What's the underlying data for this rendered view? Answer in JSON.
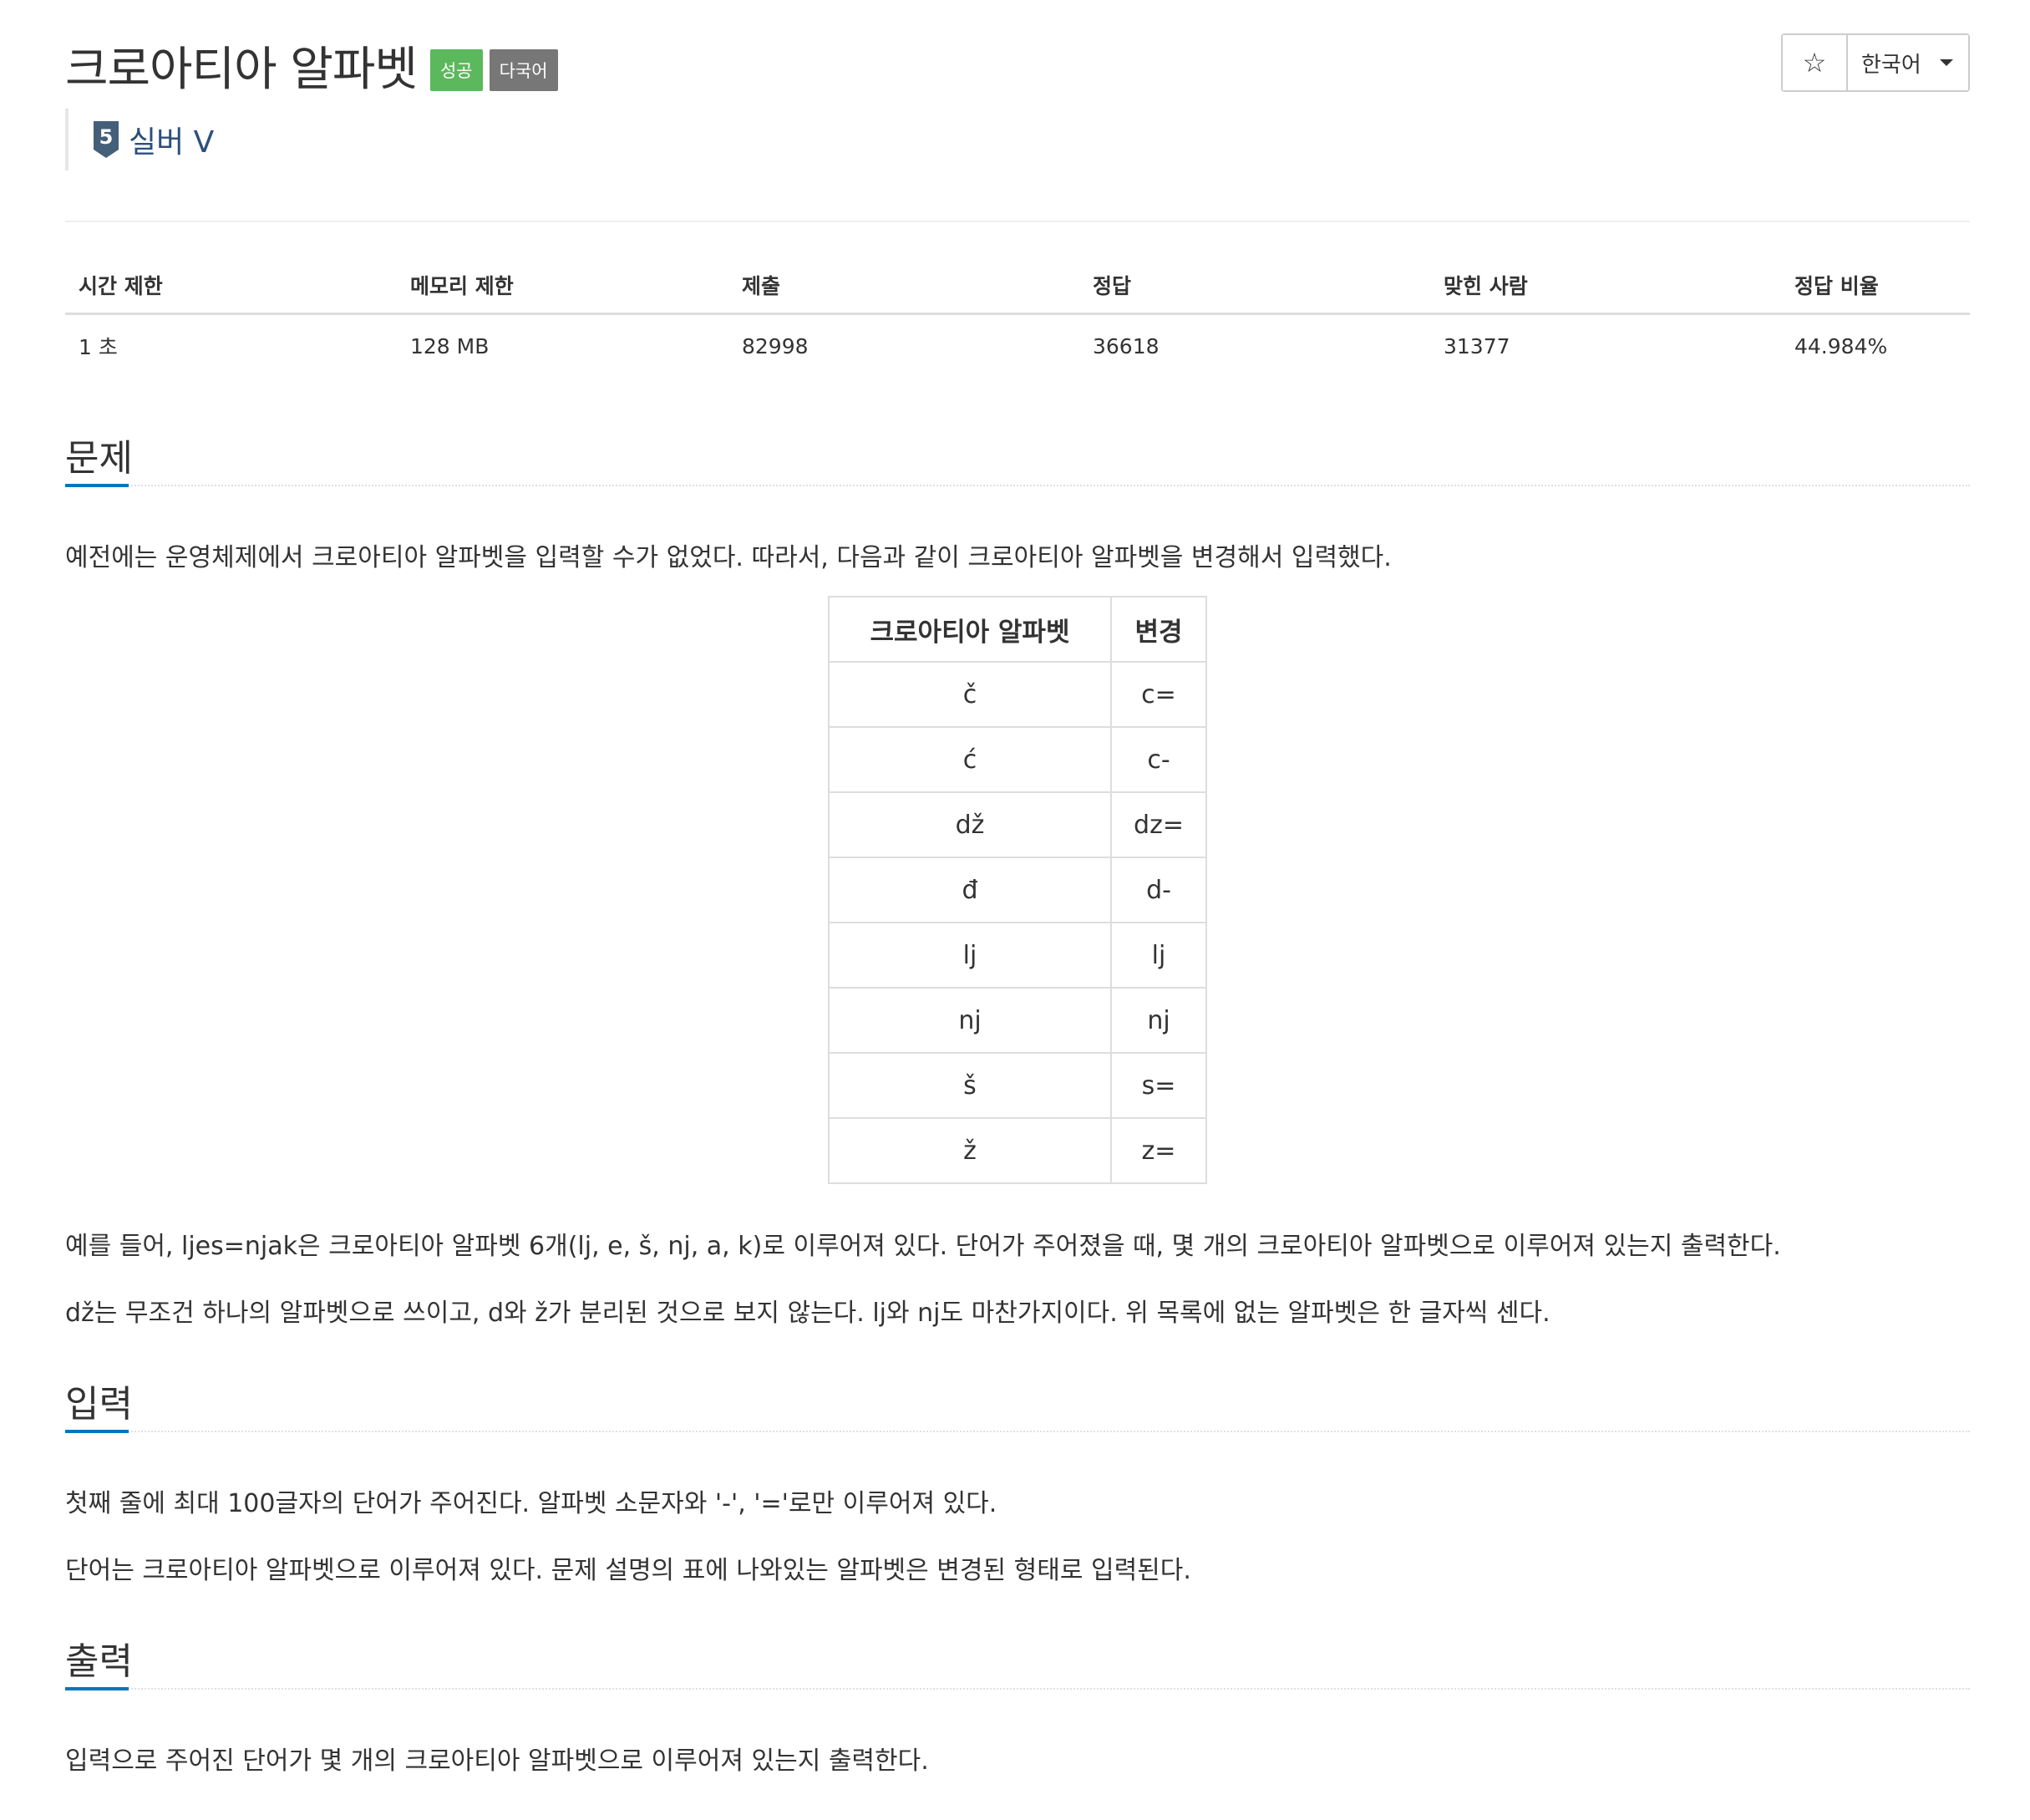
{
  "problem": {
    "title": "크로아티아 알파벳",
    "badges": {
      "success": "성공",
      "multilang": "다국어"
    },
    "tier": {
      "number": "5",
      "label": "실버 V"
    }
  },
  "toolbar": {
    "star_icon": "star-icon",
    "language": "한국어"
  },
  "info_table": {
    "headers": [
      "시간 제한",
      "메모리 제한",
      "제출",
      "정답",
      "맞힌 사람",
      "정답 비율"
    ],
    "values": [
      "1 초",
      "128 MB",
      "82998",
      "36618",
      "31377",
      "44.984%"
    ]
  },
  "sections": {
    "description": {
      "heading": "문제",
      "intro": "예전에는 운영체제에서 크로아티아 알파벳을 입력할 수가 없었다. 따라서, 다음과 같이 크로아티아 알파벳을 변경해서 입력했다.",
      "table": {
        "headers": [
          "크로아티아 알파벳",
          "변경"
        ],
        "rows": [
          [
            "č",
            "c="
          ],
          [
            "ć",
            "c-"
          ],
          [
            "dž",
            "dz="
          ],
          [
            "đ",
            "d-"
          ],
          [
            "lj",
            "lj"
          ],
          [
            "nj",
            "nj"
          ],
          [
            "š",
            "s="
          ],
          [
            "ž",
            "z="
          ]
        ]
      },
      "paragraph2": "예를 들어, ljes=njak은 크로아티아 알파벳 6개(lj, e, š, nj, a, k)로 이루어져 있다. 단어가 주어졌을 때, 몇 개의 크로아티아 알파벳으로 이루어져 있는지 출력한다.",
      "paragraph3": "dž는 무조건 하나의 알파벳으로 쓰이고, d와 ž가 분리된 것으로 보지 않는다. lj와 nj도 마찬가지이다. 위 목록에 없는 알파벳은 한 글자씩 센다."
    },
    "input": {
      "heading": "입력",
      "paragraph1": "첫째 줄에 최대 100글자의 단어가 주어진다. 알파벳 소문자와 '-', '='로만 이루어져 있다.",
      "paragraph2": "단어는 크로아티아 알파벳으로 이루어져 있다. 문제 설명의 표에 나와있는 알파벳은 변경된 형태로 입력된다."
    },
    "output": {
      "heading": "출력",
      "paragraph1": "입력으로 주어진 단어가 몇 개의 크로아티아 알파벳으로 이루어져 있는지 출력한다."
    }
  },
  "colors": {
    "success_badge": "#5cb85c",
    "multilang_badge": "#777777",
    "tier_silver": "#2c4f7c",
    "section_accent": "#0076c0"
  }
}
